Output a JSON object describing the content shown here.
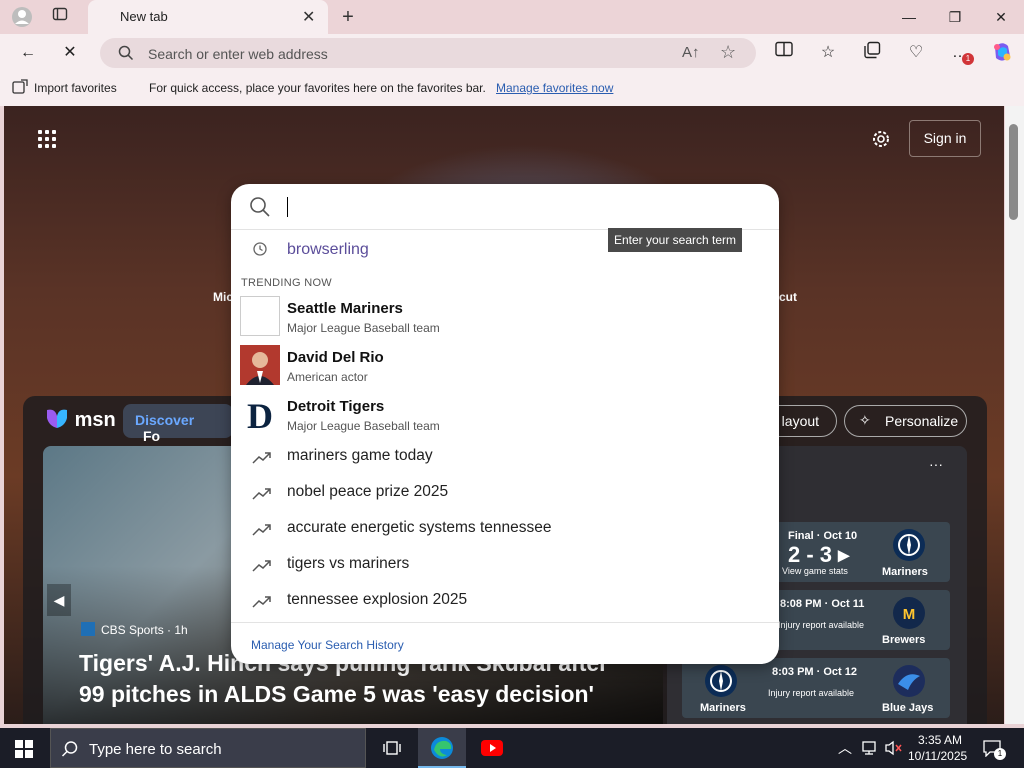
{
  "browser": {
    "tab_title": "New tab",
    "address_placeholder": "Search or enter web address",
    "notification_count": "1"
  },
  "favorites_bar": {
    "import_label": "Import favorites",
    "message": "For quick access, place your favorites here on the favorites bar.",
    "manage_link": "Manage favorites now"
  },
  "msn": {
    "sign_in": "Sign in",
    "logo": "msn",
    "discover_tab": "Discover",
    "next_tab_partial": "Fo",
    "layout_button": "d layout",
    "personalize_button": "Personalize",
    "side_left_partial": "Mic",
    "side_right_partial": "cut",
    "hero": {
      "source": "CBS Sports",
      "age": "1h",
      "headline": "Tigers' A.J. Hinch says pulling Tarik Skubal after 99 pitches in ALDS Game 5 was 'easy decision'"
    },
    "sports": {
      "area_partial": "ea",
      "games": [
        {
          "status": "Final · Oct 10",
          "score": "2 - 3 ▸",
          "sub": "View game stats",
          "right_team": "Mariners"
        },
        {
          "status": "8:08 PM · Oct 11",
          "sub": "Injury report available",
          "right_team": "Brewers"
        },
        {
          "status": "8:03 PM · Oct 12",
          "sub": "Injury report available",
          "left_team": "Mariners",
          "right_team": "Blue Jays"
        }
      ]
    }
  },
  "search_dropdown": {
    "input_value": "",
    "history": [
      {
        "text": "browserling"
      }
    ],
    "trending_heading": "TRENDING NOW",
    "entities": [
      {
        "name": "Seattle Mariners",
        "desc": "Major League Baseball team"
      },
      {
        "name": "David Del Rio",
        "desc": "American actor"
      },
      {
        "name": "Detroit Tigers",
        "desc": "Major League Baseball team"
      }
    ],
    "trends": [
      {
        "text": "mariners game today"
      },
      {
        "text": "nobel peace prize 2025"
      },
      {
        "text": "accurate energetic systems tennessee"
      },
      {
        "text": "tigers vs mariners"
      },
      {
        "text": "tennessee explosion 2025"
      }
    ],
    "footer_link": "Manage Your Search History",
    "tooltip": "Enter your search term"
  },
  "taskbar": {
    "search_placeholder": "Type here to search",
    "time": "3:35 AM",
    "date": "10/11/2025",
    "notification_count": "1"
  }
}
